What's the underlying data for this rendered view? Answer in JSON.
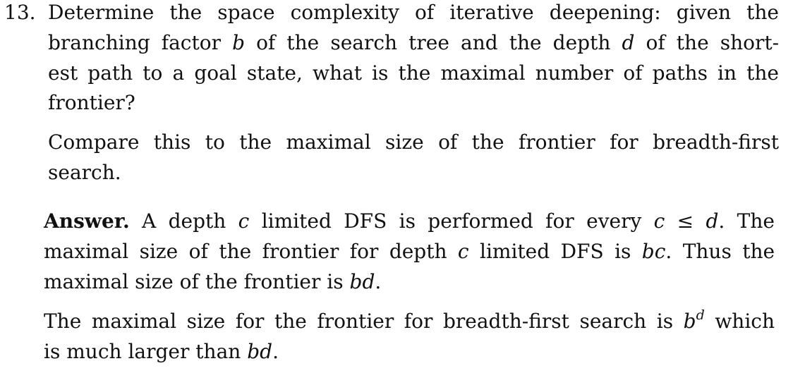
{
  "question": {
    "number": "13.",
    "lines": [
      "Determine the space complexity of iterative deepening: given the",
      "branching factor b of the search tree and the depth d of the short-",
      "est path to a goal state, what is the maximal number of paths in the",
      "frontier?"
    ],
    "compare_lines": [
      "Compare this to the maximal size of the frontier for breadth-first",
      "search."
    ]
  },
  "answer": {
    "label": "Answer.",
    "line1": "A depth c limited DFS is performed for every c ≤ d. The",
    "line2": "maximal size of the frontier for depth c limited DFS is bc. Thus the",
    "line3": "maximal size of the frontier is bd.",
    "line4": "The maximal size for the frontier for breadth-first search is b^d which",
    "line5": "is much larger than bd."
  }
}
